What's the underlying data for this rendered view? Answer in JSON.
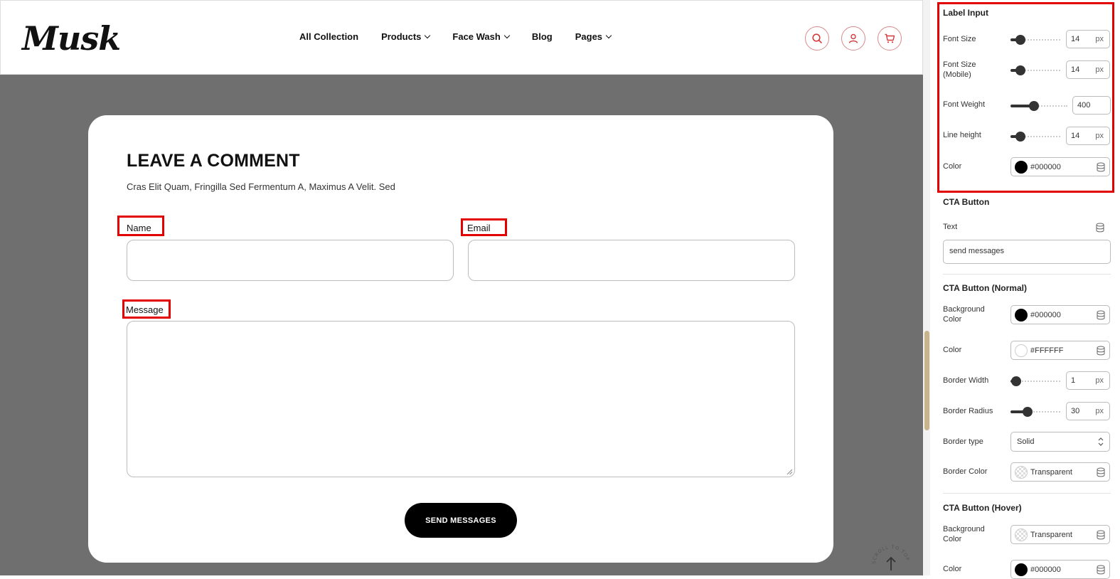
{
  "header": {
    "logo": "Musk",
    "nav": [
      {
        "label": "All Collection"
      },
      {
        "label": "Products"
      },
      {
        "label": "Face Wash"
      },
      {
        "label": "Blog"
      },
      {
        "label": "Pages"
      }
    ]
  },
  "form": {
    "title": "LEAVE A COMMENT",
    "subtitle": "Cras Elit Quam, Fringilla Sed Fermentum A, Maximus A Velit. Sed",
    "name_label": "Name",
    "email_label": "Email",
    "message_label": "Message",
    "send_label": "SEND MESSAGES",
    "scroll_to_top": "SCROLL TO TOP"
  },
  "panel": {
    "label_input": {
      "title": "Label Input",
      "font_size": {
        "label": "Font Size",
        "value": "14",
        "unit": "px",
        "level": 0.12
      },
      "font_size_mobile": {
        "label": "Font Size (Mobile)",
        "value": "14",
        "unit": "px",
        "level": 0.12
      },
      "font_weight": {
        "label": "Font Weight",
        "value": "400",
        "level": 0.4
      },
      "line_height": {
        "label": "Line height",
        "value": "14",
        "unit": "px",
        "level": 0.12
      },
      "color": {
        "label": "Color",
        "value": "#000000",
        "swatch": "#000000"
      }
    },
    "cta_button": {
      "title": "CTA Button",
      "text_label": "Text",
      "text_value": "send messages"
    },
    "cta_normal": {
      "title": "CTA Button (Normal)",
      "bg_color": {
        "label": "Background Color",
        "value": "#000000",
        "swatch": "#000000"
      },
      "color": {
        "label": "Color",
        "value": "#FFFFFF",
        "swatch": "#FFFFFF"
      },
      "border_width": {
        "label": "Border Width",
        "value": "1",
        "unit": "px",
        "level": 0.02
      },
      "border_radius": {
        "label": "Border Radius",
        "value": "30",
        "unit": "px",
        "level": 0.3
      },
      "border_type": {
        "label": "Border type",
        "value": "Solid"
      },
      "border_color": {
        "label": "Border Color",
        "value": "Transparent"
      }
    },
    "cta_hover": {
      "title": "CTA Button (Hover)",
      "bg_color": {
        "label": "Background Color",
        "value": "Transparent"
      },
      "color": {
        "label": "Color",
        "value": "#000000",
        "swatch": "#000000"
      }
    }
  },
  "colors": {
    "accent": "#e30000",
    "preview_bg": "#6f6f6f",
    "scroll_thumb": "#c8b48a"
  }
}
